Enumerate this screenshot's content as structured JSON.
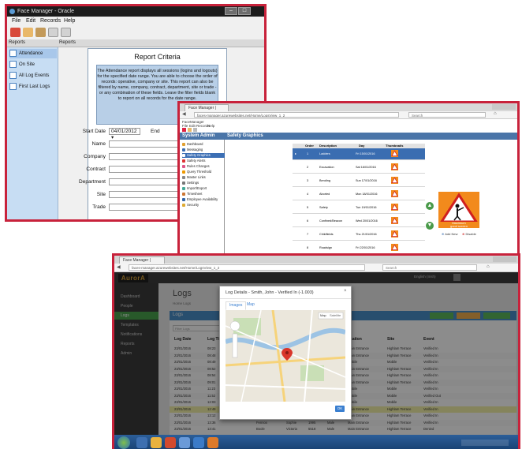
{
  "win1": {
    "title": "Face Manager - Oracle",
    "menu": [
      "File",
      "Edit",
      "Records",
      "Help"
    ],
    "pane_headers": {
      "left": "Reports",
      "right": "Reports"
    },
    "sidebar": [
      "Attendance",
      "On Site",
      "All Log Events",
      "First Last Logs"
    ],
    "criteria": {
      "title": "Report Criteria",
      "description": "The Attendance report displays all sessions (logins and logouts) for the specified date range. You are able to choose the order of records: operative, company or site. This report can also be filtered by name, company, contract, department, site or trade - or any combination of these fields. Leave the filter fields blank to report on all records for the date range.",
      "start_date_label": "Start Date",
      "start_date_value": "04/01/2012",
      "end_date_label": "End",
      "fields": [
        "Name",
        "Company",
        "Contract",
        "Department",
        "Site",
        "Trade"
      ]
    }
  },
  "win2": {
    "tab": "Face Manager |",
    "url": "faces-manager.azurewebsites.net/Home/LogsView_1_2",
    "search": "Search",
    "app_title": "FaceManager",
    "app_menu": [
      "File",
      "Edit",
      "Records",
      "Help"
    ],
    "header_left": "System Admin",
    "header_right": "Safety Graphics",
    "sidebar": [
      "Dashboard",
      "Messaging",
      "Safety Graphics",
      "Safety Alerts",
      "Rules Changes",
      "Query Threshold",
      "Master Links",
      "Settings",
      "Import/Export",
      "Timesheet",
      "Employee Availability",
      "Security"
    ],
    "table": {
      "headers": [
        "Order",
        "Description",
        "Day",
        "Thumbnails"
      ],
      "rows": [
        {
          "order": "1",
          "description": "Ladders",
          "day": "Fri 15/01/2016"
        },
        {
          "order": "2",
          "description": "Excavation",
          "day": "Sat 16/01/2016"
        },
        {
          "order": "3",
          "description": "Bending",
          "day": "Sun 17/01/2016"
        },
        {
          "order": "4",
          "description": "Aborted",
          "day": "Mon 18/01/2016"
        },
        {
          "order": "5",
          "description": "Safety",
          "day": "Tue 19/01/2016"
        },
        {
          "order": "6",
          "description": "Confined/Beacon",
          "day": "Wed 20/01/2016"
        },
        {
          "order": "7",
          "description": "Childfields",
          "day": "Thu 21/01/2016"
        },
        {
          "order": "8",
          "description": "Roadsign",
          "day": "Fri 22/01/2016"
        }
      ]
    },
    "preview_caption": [
      "Maximum",
      "good screen"
    ],
    "preview_actions": [
      "Add New",
      "Disable"
    ]
  },
  "win3": {
    "tab": "Face Manager |",
    "url": "faces-manager.azurewebsites.net/Home/LogsView_1_2",
    "search": "Search",
    "logo": "AurorA",
    "user": "English (Irish)",
    "nav": [
      "Dashboard",
      "People",
      "Logs",
      "Templates",
      "Notifications",
      "Reports",
      "Admin"
    ],
    "page_title": "Logs",
    "breadcrumb": "Home  Logs",
    "panel_title": "Logs",
    "filter_placeholder": "Filter Logs",
    "columns": [
      "Log Date",
      "Log Time",
      "",
      "",
      "",
      "",
      "ocation",
      "Site",
      "Event"
    ],
    "rows": [
      {
        "date": "23/01/2016",
        "time": "08:23",
        "loc": "Main Entrance",
        "site": "Highlam Terrace",
        "event": "Verified In"
      },
      {
        "date": "23/01/2016",
        "time": "08:48",
        "loc": "Main Entrance",
        "site": "Highlam Terrace",
        "event": "Verified In"
      },
      {
        "date": "23/01/2016",
        "time": "08:49",
        "loc": "Mobile",
        "site": "Mobile",
        "event": "Verified In"
      },
      {
        "date": "23/01/2016",
        "time": "08:52",
        "loc": "Main Entrance",
        "site": "Highlam Terrace",
        "event": "Verified In"
      },
      {
        "date": "23/01/2016",
        "time": "08:54",
        "loc": "Main Entrance",
        "site": "Highlam Terrace",
        "event": "Verified In"
      },
      {
        "date": "23/01/2016",
        "time": "09:01",
        "loc": "Main Entrance",
        "site": "Highlam Terrace",
        "event": "Verified In"
      },
      {
        "date": "23/01/2016",
        "time": "11:23",
        "loc": "Mobile",
        "site": "Mobile",
        "event": "Verified In"
      },
      {
        "date": "23/01/2016",
        "time": "11:52",
        "loc": "Mobile",
        "site": "Mobile",
        "event": "Verified Out"
      },
      {
        "date": "23/01/2016",
        "time": "12:03",
        "loc": "Mobile",
        "site": "Mobile",
        "event": "Verified In"
      },
      {
        "date": "23/01/2016",
        "time": "12:49",
        "loc": "Main Entrance",
        "site": "Highlam Terrace",
        "event": "Verified In"
      },
      {
        "date": "23/01/2016",
        "time": "13:12",
        "name": "Van Den Berg",
        "first": "Chris",
        "id": "5115",
        "type": "Male",
        "loc": "Main Entrance",
        "site": "Highlam Terrace",
        "event": "Verified In"
      },
      {
        "date": "23/01/2016",
        "time": "13:36",
        "name": "Fennox",
        "first": "Sophie",
        "id": "1995",
        "type": "Male",
        "loc": "Main Entrance",
        "site": "Highlam Terrace",
        "event": "Verified In"
      },
      {
        "date": "23/01/2016",
        "time": "13:41",
        "name": "Boole",
        "first": "Victoria",
        "id": "5518",
        "type": "Male",
        "loc": "Main Entrance",
        "site": "Highlam Terrace",
        "event": "Denied"
      }
    ],
    "modal": {
      "title": "Log Details - Smith, John - Verified In (-1.003)",
      "tabs": [
        "Images",
        "Map"
      ],
      "map_labels": [
        "Map",
        "Satellite"
      ],
      "ok": "OK"
    }
  },
  "colors": {
    "frame": "#c8223b",
    "accent_blue": "#4a75a8",
    "aurora_green": "#4aa24e"
  }
}
